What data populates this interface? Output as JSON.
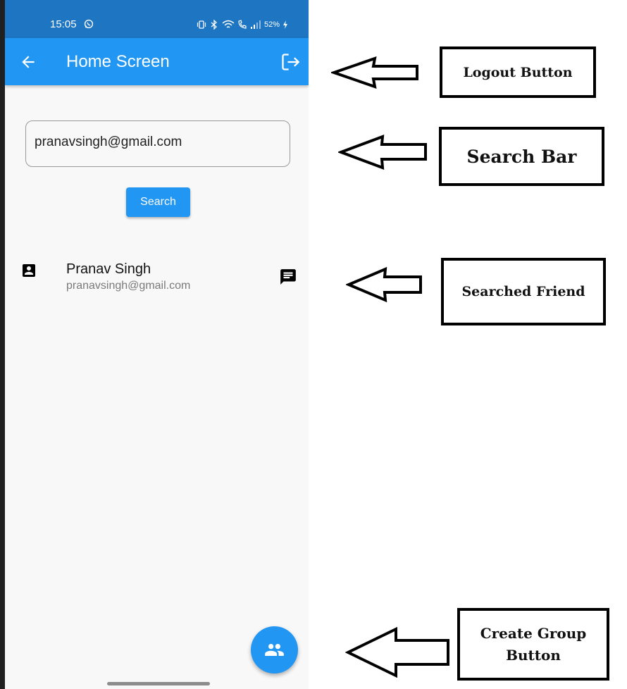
{
  "status_bar": {
    "time": "15:05",
    "battery": "52%"
  },
  "app_bar": {
    "title": "Home Screen",
    "back_icon": "arrow-back-icon",
    "logout_icon": "logout-icon"
  },
  "search": {
    "input_value": "pranavsingh@gmail.com",
    "button_label": "Search"
  },
  "friend": {
    "name": "Pranav Singh",
    "email": "pranavsingh@gmail.com",
    "contact_icon": "contact-icon",
    "chat_icon": "chat-icon"
  },
  "fab": {
    "icon": "group-icon"
  },
  "annotations": {
    "logout": "Logout Button",
    "search_bar": "Search Bar",
    "searched_friend": "Searched Friend",
    "create_group_line1": "Create Group",
    "create_group_line2": "Button"
  },
  "colors": {
    "primary": "#2196f3",
    "status_bar": "#1e75c2",
    "background": "#f8f8f8"
  }
}
